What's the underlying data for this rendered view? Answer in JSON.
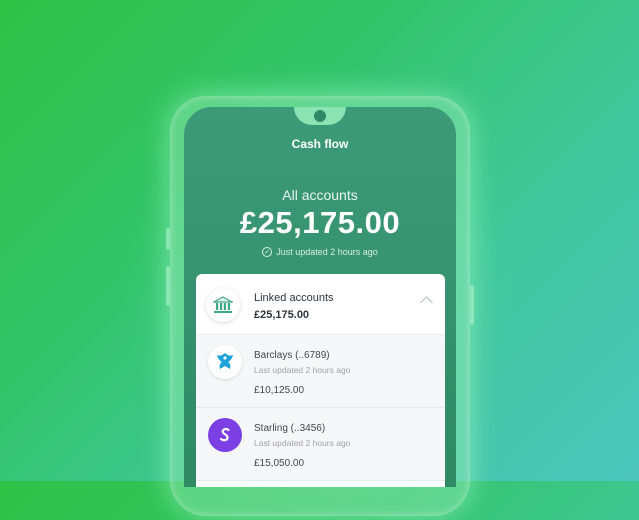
{
  "app": {
    "screen_title": "Cash flow"
  },
  "summary": {
    "label": "All accounts",
    "balance": "£25,175.00",
    "updated": "Just updated 2 hours ago"
  },
  "linked": {
    "title": "Linked accounts",
    "amount": "£25,175.00",
    "icon": "bank-icon"
  },
  "accounts": [
    {
      "name": "Barclays (..6789)",
      "updated": "Last updated 2 hours ago",
      "amount": "£10,125.00",
      "icon": "barclays-eagle-icon",
      "color": "#1aa3d9"
    },
    {
      "name": "Starling (..3456)",
      "updated": "Last updated 2 hours ago",
      "amount": "£15,050.00",
      "icon": "starling-s-icon",
      "color": "#7b3fe4"
    }
  ],
  "colors": {
    "background_start": "#2fc246",
    "background_end": "#4cc6bd",
    "screen": "#3a9875",
    "card": "#ffffff"
  }
}
